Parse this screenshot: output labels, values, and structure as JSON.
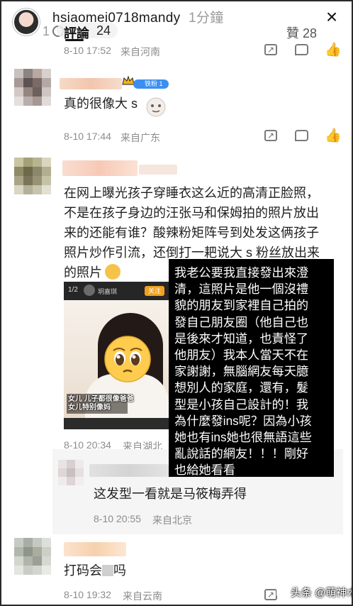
{
  "story": {
    "username": "hsiaomei0718mandy",
    "time": "1分鐘",
    "close": "×"
  },
  "behind_header": {
    "left_count": "1",
    "tab_label": "評論",
    "tab_count": "24",
    "likes_label": "贊 28"
  },
  "icons": {
    "share": "share-icon",
    "comment": "comment-icon",
    "like": "thumbs-up-icon"
  },
  "colors": {
    "overlay_bg": "#000000",
    "overlay_text": "#ffffff",
    "badge": "#3d8ef0",
    "meta_text": "#8c8c8c"
  },
  "comments": [
    {
      "date": "8-10 17:52",
      "location": "来自河南"
    },
    {
      "badge": "铁粉 1",
      "text": "真的很像大 s",
      "date": "8-10 17:44",
      "location": "来自广东"
    },
    {
      "lines": [
        "在网上曝光孩子穿睡衣这么近的高清正脸照，",
        "不是在孩子身边的汪张马和保姆拍的照片放出",
        "来的还能有谁？酸辣粉矩阵号到处发这俩孩子",
        "照片炒作引流，还倒打一耙说大 s 粉丝放出来",
        "的照片"
      ],
      "embedded": {
        "pager": "1/2",
        "account": "玥嘉琪",
        "follow": "关注",
        "caption_1": "女儿 儿子都很像爸爸",
        "caption_2": "女儿特别像妈"
      },
      "date": "8-10 20:34",
      "location": "来自湖北"
    },
    {
      "text": "这发型一看就是马筱梅弄得",
      "date": "8-10 20:55",
      "location": "来自北京"
    },
    {
      "text": "打码会",
      "text_tail": "吗",
      "date": "8-10 19:32",
      "location": "来自云南"
    }
  ],
  "overlay": {
    "lines": [
      "我老公要我直接發出來澄",
      "清，這照片是他一個沒禮",
      "貌的朋友到家裡自己拍的",
      "發自己朋友圈（他自己也",
      "是後來才知道，也責怪了",
      "他朋友）我本人當天不在",
      "家謝謝，無腦網友每天臆",
      "想別人的家庭，還有，髮",
      "型是小孩自己設計的！我",
      "為什麼發ins呢？因為小孩",
      "她也有ins她也很無語這些",
      "亂說話的網友！！！剛好",
      "也給她看看"
    ]
  },
  "watermark": "头条 @萌神木木"
}
